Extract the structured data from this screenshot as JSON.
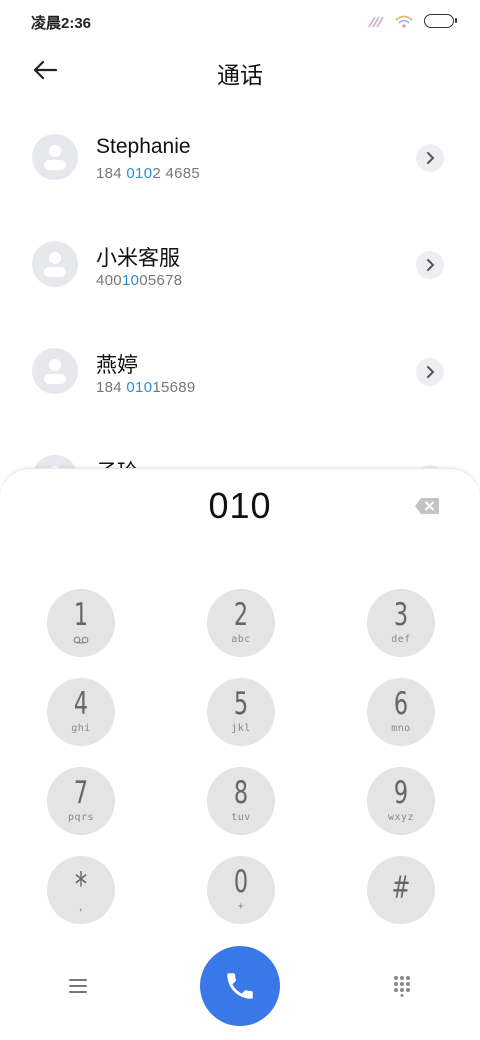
{
  "status_bar": {
    "time": "凌晨2:36"
  },
  "header": {
    "title": "通话"
  },
  "contacts": [
    {
      "name": "Stephanie",
      "number_pre": "184 ",
      "number_match": "010",
      "number_post": "2 4685"
    },
    {
      "name": "小米客服",
      "number_pre": "400",
      "number_match": "10",
      "number_post": "05678"
    },
    {
      "name": "燕婷",
      "number_pre": "184 ",
      "number_match": "010",
      "number_post": "15689"
    },
    {
      "name": "子玲",
      "number_pre": "",
      "number_match": "",
      "number_post": ""
    }
  ],
  "dialer": {
    "input": "010",
    "keys": [
      {
        "digit": "1",
        "letters": ""
      },
      {
        "digit": "2",
        "letters": "abc"
      },
      {
        "digit": "3",
        "letters": "def"
      },
      {
        "digit": "4",
        "letters": "ghi"
      },
      {
        "digit": "5",
        "letters": "jkl"
      },
      {
        "digit": "6",
        "letters": "mno"
      },
      {
        "digit": "7",
        "letters": "pqrs"
      },
      {
        "digit": "8",
        "letters": "tuv"
      },
      {
        "digit": "9",
        "letters": "wxyz"
      },
      {
        "digit": "*",
        "letters": ","
      },
      {
        "digit": "0",
        "letters": "+"
      },
      {
        "digit": "#",
        "letters": ""
      }
    ]
  },
  "colors": {
    "accent": "#3a78e8",
    "match_highlight": "#2a8fd6",
    "key_bg": "#e4e4e4"
  },
  "icons": {
    "back": "arrow-left-icon",
    "detail": "chevron-right-icon",
    "delete": "backspace-icon",
    "call": "phone-icon",
    "menu": "hamburger-menu-icon",
    "keypad": "dialpad-icon",
    "voicemail": "voicemail-icon"
  }
}
